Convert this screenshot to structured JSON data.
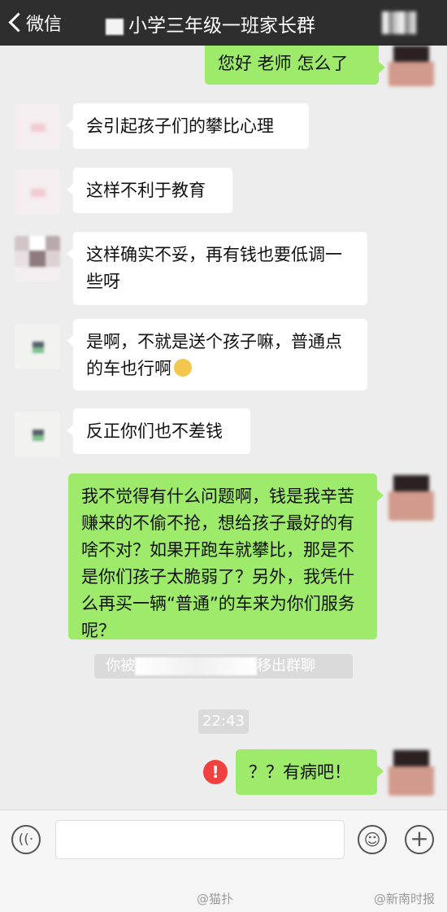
{
  "header": {
    "back_label": "微信",
    "title": "小学三年级一班家长群"
  },
  "messages": [
    {
      "id": "m1",
      "side": "right",
      "text": "您好 老师 怎么了"
    },
    {
      "id": "m2",
      "side": "left",
      "text": "会引起孩子们的攀比心理"
    },
    {
      "id": "m3",
      "side": "left",
      "text": "这样不利于教育"
    },
    {
      "id": "m4",
      "side": "left",
      "text": "这样确实不妥，再有钱也要低调一些呀"
    },
    {
      "id": "m5",
      "side": "left",
      "text": "是啊，不就是送个孩子嘛，普通点的车也行啊",
      "emoji": "smirk-face"
    },
    {
      "id": "m6",
      "side": "left",
      "text": "反正你们也不差钱"
    },
    {
      "id": "m7",
      "side": "right",
      "text": "我不觉得有什么问题啊，钱是我辛苦赚来的不偷不抢，想给孩子最好的有啥不对？如果开跑车就攀比，那是不是你们孩子太脆弱了？另外，我凭什么再买一辆“普通”的车来为你们服务呢？"
    },
    {
      "id": "m8",
      "side": "right",
      "text": "？？有病吧！",
      "failed": true
    }
  ],
  "system": {
    "removed_prefix": "你被",
    "removed_suffix": "移出群聊",
    "timestamp": "22:43"
  },
  "error_mark": "!",
  "input_bar": {
    "voice_icon": "voice-icon",
    "emoji_icon": "emoji-icon",
    "plus_icon": "plus-icon",
    "plus_glyph": "+"
  },
  "watermarks": [
    "@猫扑",
    "@新南时报"
  ]
}
